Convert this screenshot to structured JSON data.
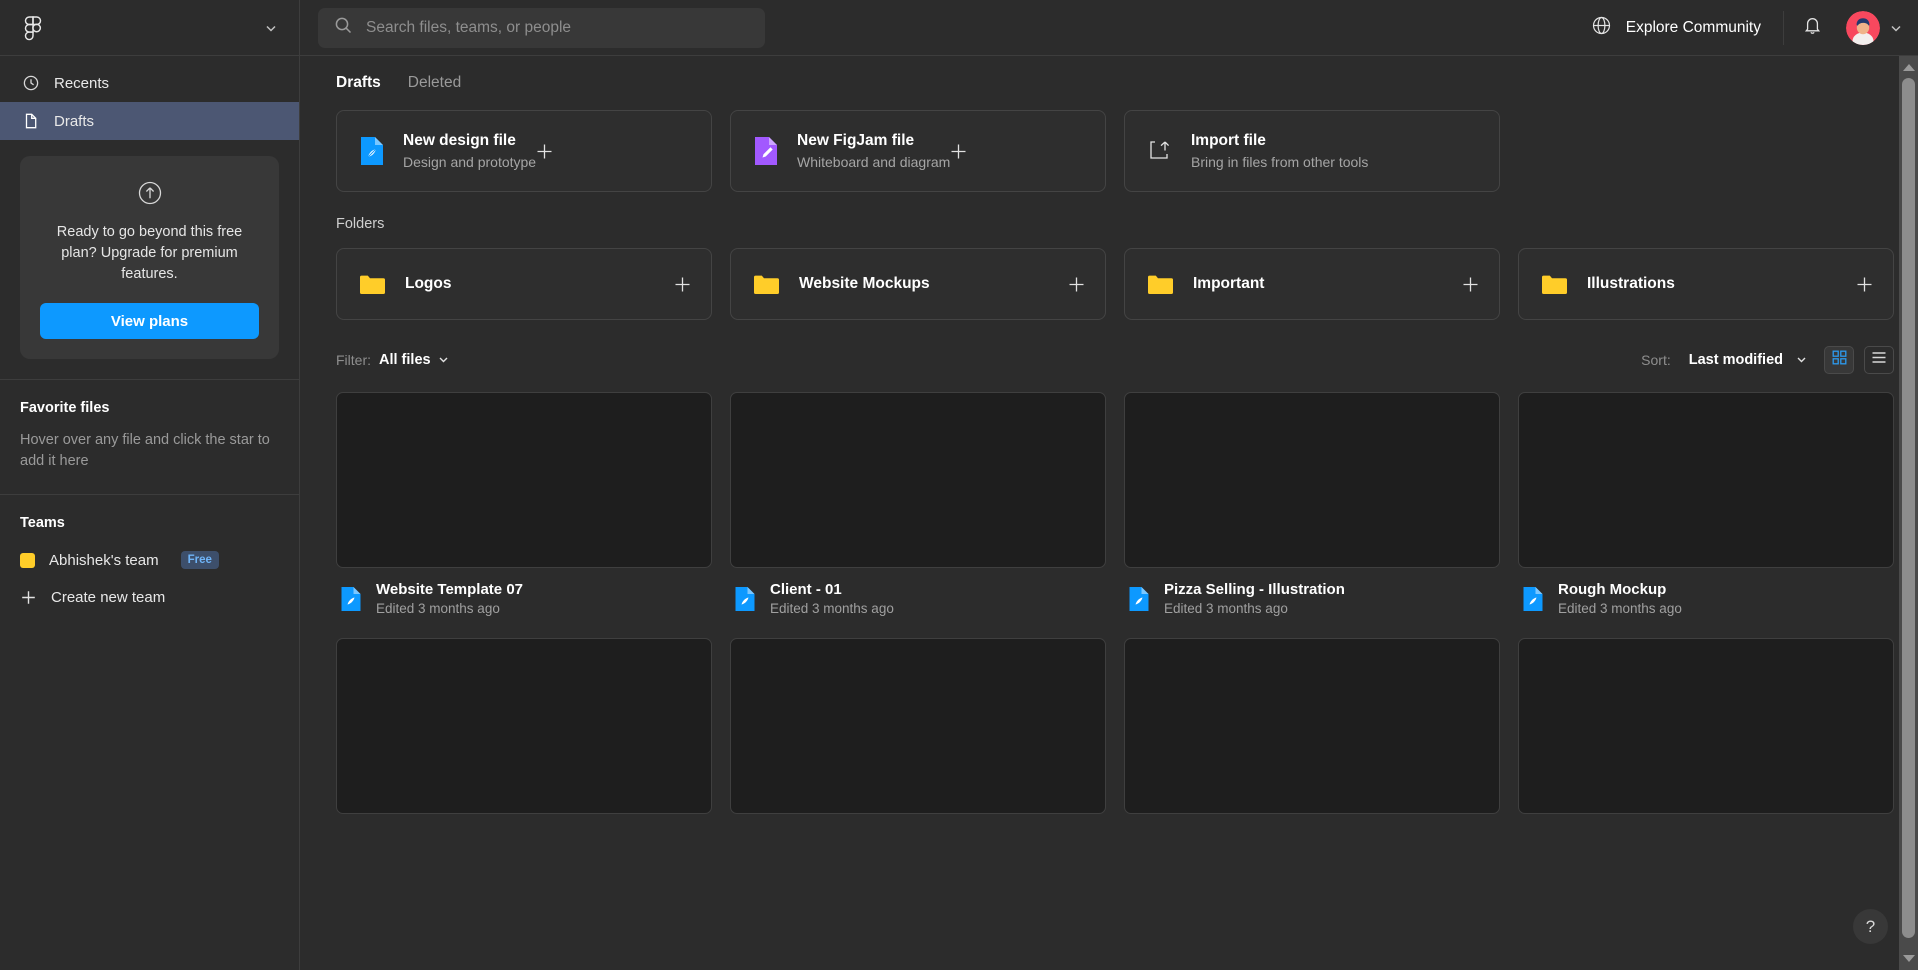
{
  "sidebar": {
    "logo_icon": "figma-logo",
    "account_chevron": "chevron-down-icon",
    "nav": [
      {
        "label": "Recents",
        "icon": "clock-icon",
        "active": false
      },
      {
        "label": "Drafts",
        "icon": "file-icon",
        "active": true
      }
    ],
    "upgrade": {
      "icon": "arrow-up-circle-icon",
      "text": "Ready to go beyond this free plan? Upgrade for premium features.",
      "button_label": "View plans"
    },
    "favorites": {
      "title": "Favorite files",
      "hint": "Hover over any file and click the star to add it here"
    },
    "teams": {
      "title": "Teams",
      "items": [
        {
          "name": "Abhishek's team",
          "badge": "Free",
          "swatch_color": "#ffcd29"
        }
      ],
      "create_label": "Create new team"
    }
  },
  "header": {
    "search_placeholder": "Search files, teams, or people",
    "search_value": "",
    "search_icon": "search-icon",
    "explore_label": "Explore Community",
    "globe_icon": "globe-icon",
    "bell_icon": "bell-icon",
    "avatar_icon": "user-avatar",
    "avatar_chevron": "chevron-down-icon"
  },
  "main": {
    "tabs": [
      {
        "label": "Drafts",
        "active": true
      },
      {
        "label": "Deleted",
        "active": false
      }
    ],
    "actions": [
      {
        "title": "New design file",
        "subtitle": "Design and prototype",
        "icon": "design-file-icon",
        "color": "#0d99ff",
        "plus": "plus-icon"
      },
      {
        "title": "New FigJam file",
        "subtitle": "Whiteboard and diagram",
        "icon": "figjam-file-icon",
        "color": "#a259ff",
        "plus": "plus-icon"
      },
      {
        "title": "Import file",
        "subtitle": "Bring in files from other tools",
        "icon": "import-icon",
        "color": "#ffffff",
        "plus": ""
      }
    ],
    "folders_label": "Folders",
    "folders": [
      {
        "name": "Logos",
        "icon": "folder-icon",
        "plus": "plus-icon"
      },
      {
        "name": "Website Mockups",
        "icon": "folder-icon",
        "plus": "plus-icon"
      },
      {
        "name": "Important",
        "icon": "folder-icon",
        "plus": "plus-icon"
      },
      {
        "name": "Illustrations",
        "icon": "folder-icon",
        "plus": "plus-icon"
      }
    ],
    "filterbar": {
      "filter_label": "Filter:",
      "filter_value": "All files",
      "sort_label": "Sort:",
      "sort_value": "Last modified",
      "grid_view_icon": "grid-view-icon",
      "list_view_icon": "list-view-icon",
      "active_view": "grid"
    },
    "files": [
      {
        "title": "Website Template 07",
        "subtitle": "Edited 3 months ago",
        "icon": "design-file-icon"
      },
      {
        "title": "Client - 01",
        "subtitle": "Edited 3 months ago",
        "icon": "design-file-icon"
      },
      {
        "title": "Pizza Selling - Illustration",
        "subtitle": "Edited 3 months ago",
        "icon": "design-file-icon"
      },
      {
        "title": "Rough Mockup",
        "subtitle": "Edited 3 months ago",
        "icon": "design-file-icon"
      }
    ],
    "files_row2": [
      {
        "title": "",
        "subtitle": "",
        "icon": "design-file-icon"
      },
      {
        "title": "",
        "subtitle": "",
        "icon": "design-file-icon"
      },
      {
        "title": "",
        "subtitle": "",
        "icon": "design-file-icon"
      },
      {
        "title": "",
        "subtitle": "",
        "icon": "design-file-icon"
      }
    ]
  },
  "help": {
    "label": "?"
  },
  "colors": {
    "accent": "#0d99ff",
    "active_nav": "#4c5773",
    "folder": "#ffcd29",
    "figjam": "#a259ff",
    "background": "#2c2c2c"
  }
}
